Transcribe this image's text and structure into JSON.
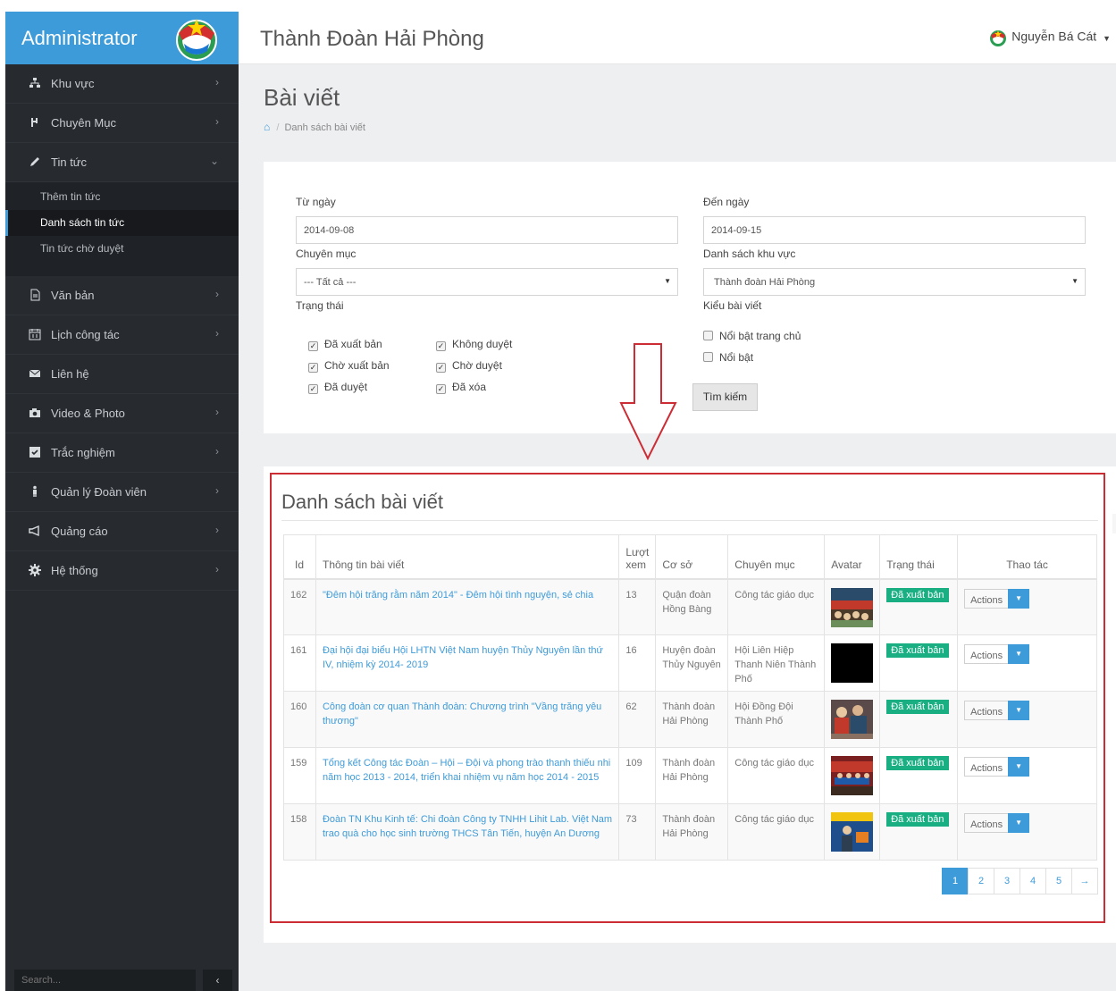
{
  "sidebar": {
    "brand": "Administrator",
    "nav": [
      {
        "label": "Khu vực",
        "icon": "sitemap-icon"
      },
      {
        "label": "Chuyên Mục",
        "icon": "fork-icon"
      },
      {
        "label": "Tin tức",
        "icon": "pencil-icon"
      },
      {
        "label": "Văn bản",
        "icon": "document-icon"
      },
      {
        "label": "Lịch công tác",
        "icon": "calendar-icon"
      },
      {
        "label": "Liên hệ",
        "icon": "envelope-icon"
      },
      {
        "label": "Video & Photo",
        "icon": "camera-icon"
      },
      {
        "label": "Trắc nghiệm",
        "icon": "checkbox-icon"
      },
      {
        "label": "Quản lý Đoàn viên",
        "icon": "person-icon"
      },
      {
        "label": "Quảng cáo",
        "icon": "megaphone-icon"
      },
      {
        "label": "Hệ thống",
        "icon": "gear-icon"
      }
    ],
    "subnav": [
      "Thêm tin tức",
      "Danh sách tin tức",
      "Tin tức chờ duyệt"
    ],
    "search_placeholder": "Search..."
  },
  "topbar": {
    "site_title": "Thành Đoàn Hải Phòng",
    "user_name": "Nguyễn Bá Cát"
  },
  "page": {
    "title": "Bài viết",
    "breadcrumb": "Danh sách bài viết"
  },
  "filter": {
    "from_label": "Từ ngày",
    "from_value": "2014-09-08",
    "to_label": "Đến ngày",
    "to_value": "2014-09-15",
    "category_label": "Chuyên mục",
    "category_value": "--- Tất cả ---",
    "region_label": "Danh sách khu vực",
    "region_value": "Thành đoàn Hải Phòng",
    "status_label": "Trạng thái",
    "status_options": [
      {
        "label": "Đã xuất bản",
        "checked": true
      },
      {
        "label": "Không duyệt",
        "checked": true
      },
      {
        "label": "Chờ xuất bản",
        "checked": true
      },
      {
        "label": "Chờ duyệt",
        "checked": true
      },
      {
        "label": "Đã duyệt",
        "checked": true
      },
      {
        "label": "Đã xóa",
        "checked": true
      }
    ],
    "type_label": "Kiểu bài viết",
    "type_options": [
      {
        "label": "Nổi bật trang chủ",
        "checked": false
      },
      {
        "label": "Nổi bật",
        "checked": false
      }
    ],
    "search_button": "Tìm kiếm"
  },
  "list": {
    "title": "Danh sách bài viết",
    "columns": [
      "Id",
      "Thông tin bài viết",
      "Lượt xem",
      "Cơ sở",
      "Chuyên mục",
      "Avatar",
      "Trạng thái",
      "Thao tác"
    ],
    "rows": [
      {
        "id": "162",
        "title": "\"Đêm hội trăng rằm năm 2014\" - Đêm hội tình nguyện, sẻ chia",
        "views": "13",
        "unit": "Quận đoàn Hồng Bàng",
        "category": "Công tác giáo dục",
        "status": "Đã xuất bản",
        "action": "Actions"
      },
      {
        "id": "161",
        "title": "Đại hội đại biểu Hội LHTN Việt Nam huyện Thủy Nguyên lần thứ IV, nhiệm kỳ 2014- 2019",
        "views": "16",
        "unit": "Huyện đoàn Thủy Nguyên",
        "category": "Hội Liên Hiệp Thanh Niên Thành Phố",
        "status": "Đã xuất bản",
        "action": "Actions"
      },
      {
        "id": "160",
        "title": "Công đoàn cơ quan Thành đoàn: Chương trình \"Vầng trăng yêu thương\"",
        "views": "62",
        "unit": "Thành đoàn Hải Phòng",
        "category": "Hội Đồng Đội Thành Phố",
        "status": "Đã xuất bản",
        "action": "Actions"
      },
      {
        "id": "159",
        "title": "Tổng kết Công tác Đoàn – Hội – Đội và phong trào thanh thiếu nhi năm học 2013 - 2014, triển khai nhiệm vụ năm học 2014 - 2015",
        "views": "109",
        "unit": "Thành đoàn Hải Phòng",
        "category": "Công tác giáo dục",
        "status": "Đã xuất bản",
        "action": "Actions"
      },
      {
        "id": "158",
        "title": "Đoàn TN Khu Kinh tế: Chi đoàn Công ty TNHH Lihit Lab. Việt Nam trao quà cho học sinh trường THCS Tân Tiến, huyện An Dương",
        "views": "73",
        "unit": "Thành đoàn Hải Phòng",
        "category": "Công tác giáo dục",
        "status": "Đã xuất bản",
        "action": "Actions"
      }
    ],
    "pages": [
      "1",
      "2",
      "3",
      "4",
      "5"
    ],
    "next": "→",
    "current_page": "1"
  },
  "colors": {
    "accent": "#3e9bd9",
    "sidebar": "#272b30",
    "status_green": "#1aaf83",
    "annotation_red": "#cc2d35"
  }
}
